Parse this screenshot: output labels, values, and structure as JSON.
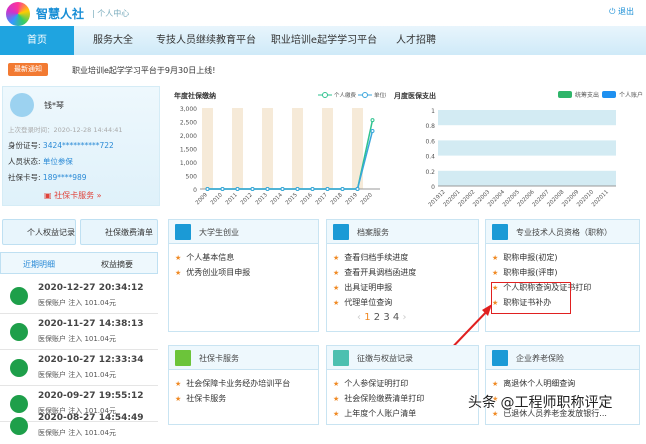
{
  "header": {
    "brand": "智慧人社",
    "subtitle": "| 个人中心",
    "logout": "退出"
  },
  "nav": [
    {
      "label": "首页"
    },
    {
      "label": "服务大全"
    },
    {
      "label": "专技人员继续教育平台"
    },
    {
      "label": "职业培训e起学学习平台"
    },
    {
      "label": "人才招聘"
    }
  ],
  "notice": {
    "badge": "最新通知",
    "text": "职业培训e起学学习平台于9月30日上线!"
  },
  "profile": {
    "name": "钱*琴",
    "last_login": "上次登录时间：2020-12-28 14:44:41",
    "id_label": "身份证号:",
    "id_value": "3424**********722",
    "status_label": "人员状态:",
    "status_value": "单位参保",
    "card_label": "社保卡号:",
    "card_value": "189****989",
    "service": "社保卡服务 »"
  },
  "quick": {
    "rights": "个人权益记录",
    "clear": "社保缴费清单"
  },
  "tabs": {
    "recent": "近期明细",
    "summary": "权益摘要"
  },
  "records": [
    {
      "time": "2020-12-27 20:34:12",
      "desc": "医保账户 注入 101.04元"
    },
    {
      "time": "2020-11-27 14:38:13",
      "desc": "医保账户 注入 101.04元"
    },
    {
      "time": "2020-10-27 12:33:34",
      "desc": "医保账户 注入 101.04元"
    },
    {
      "time": "2020-09-27 19:55:12",
      "desc": "医保账户 注入 101.04元"
    },
    {
      "time": "2020-08-27 14:54:49",
      "desc": "医保账户 注入 101.04元"
    }
  ],
  "chart_data": [
    {
      "type": "line",
      "title": "年度社保缴纳",
      "x": [
        "2009",
        "2010",
        "2011",
        "2012",
        "2013",
        "2014",
        "2015",
        "2016",
        "2017",
        "2018",
        "2019",
        "2020"
      ],
      "ylim": [
        0,
        3000
      ],
      "yticks": [
        "0",
        "500",
        "1,000",
        "1,500",
        "2,000",
        "2,500",
        "3,000"
      ],
      "series": [
        {
          "name": "个人缴费",
          "color": "#2ec28f",
          "values": [
            0,
            0,
            0,
            0,
            0,
            0,
            0,
            0,
            0,
            0,
            0,
            2550
          ]
        },
        {
          "name": "单位缴费",
          "color": "#3aa6dc",
          "values": [
            0,
            0,
            0,
            0,
            0,
            0,
            0,
            0,
            0,
            0,
            0,
            2150
          ]
        }
      ]
    },
    {
      "type": "bar",
      "title": "月度医保支出",
      "x": [
        "201912",
        "202001",
        "202002",
        "202003",
        "202004",
        "202005",
        "202006",
        "202007",
        "202008",
        "202009",
        "202010",
        "202011"
      ],
      "ylim": [
        0,
        1
      ],
      "yticks": [
        "0",
        "0.2",
        "0.4",
        "0.6",
        "0.8",
        "1"
      ],
      "series": [
        {
          "name": "统筹支出",
          "color": "#2fb56a",
          "values": [
            0,
            0,
            0,
            0,
            0,
            0,
            0,
            0,
            0,
            0,
            0,
            0
          ]
        },
        {
          "name": "个人账户",
          "color": "#1e90f0",
          "values": [
            0,
            0,
            0,
            0,
            0,
            0,
            0,
            0,
            0,
            0,
            0,
            0
          ]
        }
      ]
    }
  ],
  "cards": [
    {
      "title": "大学生创业",
      "items": [
        "个人基本信息",
        "优秀创业项目申报"
      ]
    },
    {
      "title": "档案服务",
      "items": [
        "查看归档手续进度",
        "查看开具调档函进度",
        "出具证明申报",
        "代理单位查询"
      ],
      "pages": [
        "1",
        "2",
        "3",
        "4"
      ]
    },
    {
      "title": "专业技术人员资格（职称）",
      "items": [
        "职称申报(初定)",
        "职称申报(评审)",
        "个人职称查询及证书打印",
        "职称证书补办"
      ]
    },
    {
      "title": "社保卡服务",
      "items": [
        "社会保障卡业务经办培训平台",
        "社保卡服务"
      ]
    },
    {
      "title": "征缴与权益记录",
      "items": [
        "个人参保证明打印",
        "社会保险缴费清单打印",
        "上年度个人账户清单"
      ]
    },
    {
      "title": "企业养老保险",
      "items": [
        "离退休个人明细查询",
        "",
        "已退休人员养老金发放银行..."
      ]
    }
  ],
  "watermark": "头条 @工程师职称评定"
}
